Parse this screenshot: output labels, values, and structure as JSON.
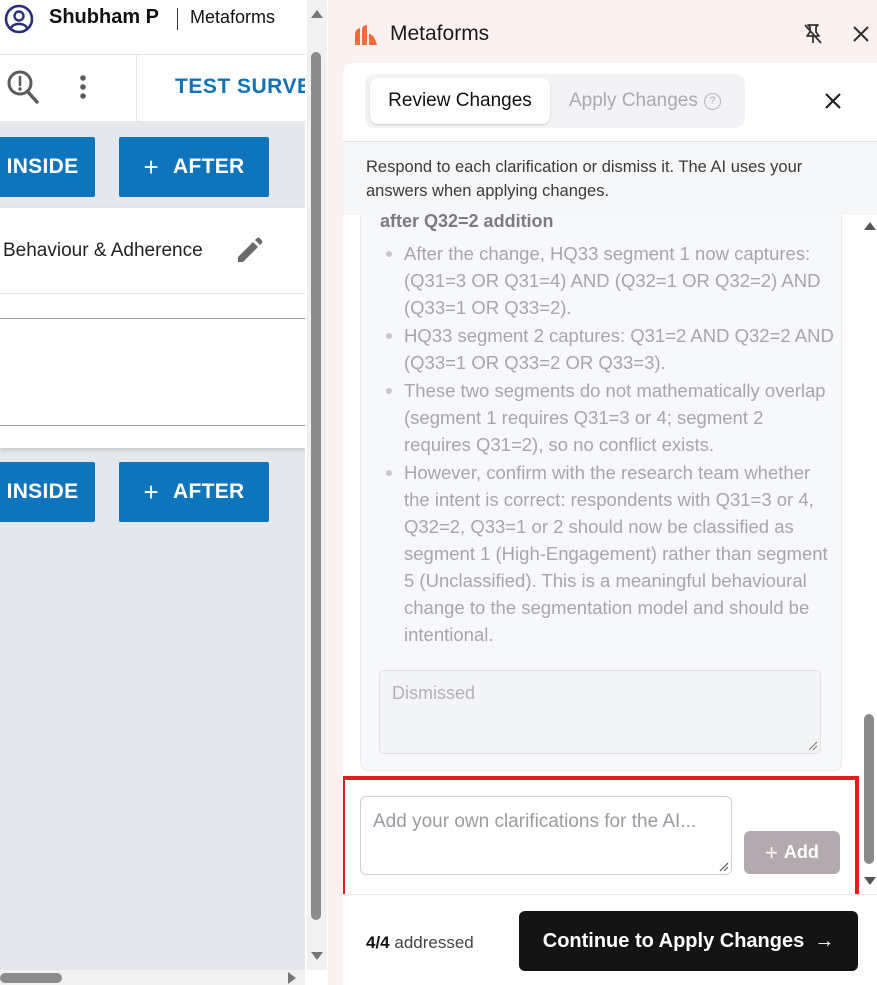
{
  "left_pane": {
    "user_name": "Shubham P",
    "brand": "Metaforms",
    "survey_link": "TEST SURVEY",
    "buttons_top": {
      "inside": "INSIDE",
      "after": "AFTER"
    },
    "card_title": "Behaviour & Adherence",
    "buttons_bottom": {
      "inside": "INSIDE",
      "after": "AFTER"
    },
    "plus_glyph": "+"
  },
  "panel": {
    "title": "Metaforms",
    "tabs": [
      {
        "label": "Review Changes",
        "active": true
      },
      {
        "label": "Apply Changes",
        "active": false
      }
    ],
    "help_glyph": "?",
    "info_text": "Respond to each clarification or dismiss it. The AI uses your answers when applying changes.",
    "item": {
      "heading": "after Q32=2 addition",
      "bullets": [
        "After the change, HQ33 segment 1 now captures: (Q31=3 OR Q31=4) AND (Q32=1 OR Q32=2) AND (Q33=1 OR Q33=2).",
        "HQ33 segment 2 captures: Q31=2 AND Q32=2 AND (Q33=1 OR Q33=2 OR Q33=3).",
        "These two segments do not mathematically overlap (segment 1 requires Q31=3 or 4; segment 2 requires Q31=2), so no conflict exists.",
        "However, confirm with the research team whether the intent is correct: respondents with Q31=3 or 4, Q32=2, Q33=1 or 2 should now be classified as segment 1 (High-Engagement) rather than segment 5 (Unclassified). This is a meaningful behavioural change to the segmentation model and should be intentional."
      ],
      "response_placeholder": "Dismissed"
    },
    "add_clarification": {
      "placeholder": "Add your own clarifications for the AI...",
      "button_label": "Add",
      "plus_glyph": "+"
    },
    "footer": {
      "count": "4/4",
      "count_suffix": "addressed",
      "continue_label": "Continue to Apply Changes",
      "arrow": "→"
    }
  },
  "colors": {
    "accent_blue": "#0e74bb",
    "highlight_red": "#de1d1d",
    "panel_bg": "#fbf2ef",
    "brand_orange": "#f26b3a"
  }
}
